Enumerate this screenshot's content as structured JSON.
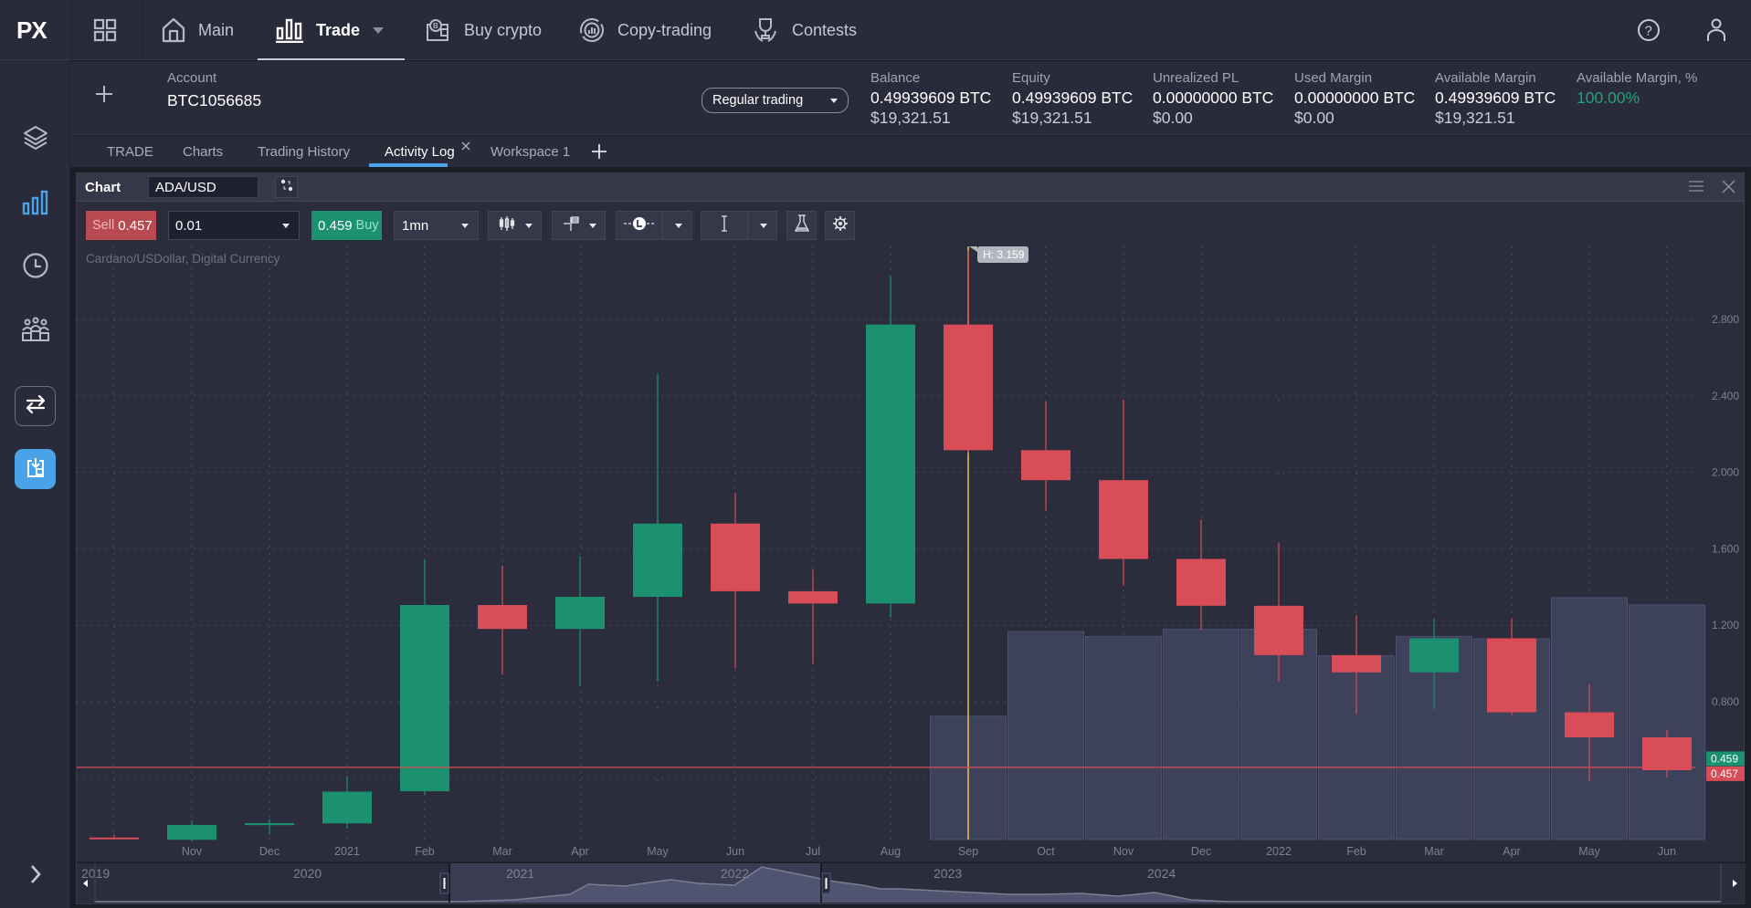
{
  "app": {
    "logo": "PX"
  },
  "topnav": {
    "items": [
      {
        "label": "Main",
        "icon": "home-icon"
      },
      {
        "label": "Trade",
        "icon": "bar-chart-icon",
        "active": true,
        "has_dropdown": true
      },
      {
        "label": "Buy crypto",
        "icon": "wallet-bitcoin-icon"
      },
      {
        "label": "Copy-trading",
        "icon": "copy-trading-icon"
      },
      {
        "label": "Contests",
        "icon": "trophy-icon"
      }
    ],
    "right_icons": [
      "help-icon",
      "user-icon"
    ]
  },
  "sidebar": {
    "items": [
      {
        "name": "layers",
        "icon": "layers-icon"
      },
      {
        "name": "charts",
        "icon": "bar-chart-icon",
        "active": true
      },
      {
        "name": "history",
        "icon": "clock-icon"
      },
      {
        "name": "community",
        "icon": "people-icon"
      },
      {
        "name": "transfer",
        "icon": "swap-arrows-icon"
      },
      {
        "name": "deposit",
        "icon": "deposit-icon",
        "highlight": true
      }
    ],
    "expand_icon": "chevron-right-icon"
  },
  "account": {
    "label": "Account",
    "id": "BTC1056685",
    "mode_select": "Regular trading",
    "stats": [
      {
        "label": "Balance",
        "btc": "0.49939609 BTC",
        "usd": "$19,321.51"
      },
      {
        "label": "Equity",
        "btc": "0.49939609 BTC",
        "usd": "$19,321.51"
      },
      {
        "label": "Unrealized PL",
        "btc": "0.00000000 BTC",
        "usd": "$0.00"
      },
      {
        "label": "Used Margin",
        "btc": "0.00000000 BTC",
        "usd": "$0.00"
      },
      {
        "label": "Available Margin",
        "btc": "0.49939609 BTC",
        "usd": "$19,321.51"
      },
      {
        "label": "Available Margin, %",
        "value": "100.00%"
      }
    ]
  },
  "tabs": [
    {
      "label": "TRADE"
    },
    {
      "label": "Charts"
    },
    {
      "label": "Trading History"
    },
    {
      "label": "Activity Log",
      "active": true,
      "closable": true
    },
    {
      "label": "Workspace 1"
    }
  ],
  "chart_panel": {
    "title": "Chart",
    "symbol": "ADA/USD",
    "subtitle": "Cardano/USDollar, Digital Currency",
    "sell": {
      "label": "Sell",
      "price": "0.457"
    },
    "buy": {
      "label": "Buy",
      "price": "0.459"
    },
    "quantity": "0.01",
    "timeframe": "1mn",
    "crosshair_label": "H: 3.159"
  },
  "colors": {
    "up": "#1b9170",
    "down": "#d84d57",
    "accent": "#4aa3e8",
    "positive_text": "#1fa27b",
    "crosshair": "#e5c54a"
  },
  "chart_data": {
    "type": "candlestick",
    "title": "Cardano/USDollar, Digital Currency",
    "ylim": [
      0.1,
      3.2
    ],
    "y_ticks": [
      "2.800",
      "2.400",
      "2.000",
      "1.600",
      "1.200",
      "0.800"
    ],
    "y_tick_values": [
      2.8,
      2.4,
      2.0,
      1.6,
      1.2,
      0.8
    ],
    "x_labels": [
      "",
      "Nov",
      "Dec",
      "2021",
      "Feb",
      "Mar",
      "Apr",
      "May",
      "Jun",
      "Jul",
      "Aug",
      "Sep",
      "Oct",
      "Nov",
      "Dec",
      "2022",
      "Feb",
      "Mar",
      "Apr",
      "May",
      "Jun"
    ],
    "candles": [
      {
        "o": 0.09,
        "h": 0.105,
        "l": 0.08,
        "c": 0.086
      },
      {
        "o": 0.078,
        "h": 0.18,
        "l": 0.07,
        "c": 0.156
      },
      {
        "o": 0.155,
        "h": 0.186,
        "l": 0.105,
        "c": 0.165
      },
      {
        "o": 0.164,
        "h": 0.41,
        "l": 0.137,
        "c": 0.33
      },
      {
        "o": 0.332,
        "h": 1.545,
        "l": 0.313,
        "c": 1.306
      },
      {
        "o": 1.306,
        "h": 1.513,
        "l": 0.942,
        "c": 1.181
      },
      {
        "o": 1.181,
        "h": 1.564,
        "l": 0.884,
        "c": 1.349
      },
      {
        "o": 1.349,
        "h": 2.516,
        "l": 0.907,
        "c": 1.732
      },
      {
        "o": 1.732,
        "h": 1.893,
        "l": 0.972,
        "c": 1.378
      },
      {
        "o": 1.378,
        "h": 1.49,
        "l": 0.997,
        "c": 1.314
      },
      {
        "o": 1.314,
        "h": 3.03,
        "l": 1.24,
        "c": 2.773
      },
      {
        "o": 2.773,
        "h": 3.159,
        "l": 2.1,
        "c": 2.116
      },
      {
        "o": 2.116,
        "h": 2.37,
        "l": 1.8,
        "c": 1.959
      },
      {
        "o": 1.959,
        "h": 2.38,
        "l": 1.408,
        "c": 1.547
      },
      {
        "o": 1.547,
        "h": 1.754,
        "l": 1.175,
        "c": 1.302
      },
      {
        "o": 1.302,
        "h": 1.633,
        "l": 0.907,
        "c": 1.044
      },
      {
        "o": 1.044,
        "h": 1.253,
        "l": 0.735,
        "c": 0.954
      },
      {
        "o": 0.954,
        "h": 1.236,
        "l": 0.762,
        "c": 1.132
      },
      {
        "o": 1.132,
        "h": 1.236,
        "l": 0.727,
        "c": 0.745
      },
      {
        "o": 0.745,
        "h": 0.892,
        "l": 0.385,
        "c": 0.614
      },
      {
        "o": 0.614,
        "h": 0.653,
        "l": 0.405,
        "c": 0.442
      }
    ],
    "volume_relative": [
      null,
      null,
      null,
      null,
      null,
      null,
      null,
      null,
      null,
      null,
      null,
      0.51,
      0.86,
      0.84,
      0.87,
      0.87,
      0.76,
      0.84,
      0.83,
      1.0,
      0.97
    ],
    "price_lines": [
      {
        "label": "0.459",
        "value": 0.459,
        "kind": "buy"
      },
      {
        "label": "0.457",
        "value": 0.457,
        "kind": "sell"
      }
    ],
    "crosshair_index": 11,
    "navigator": {
      "year_labels": [
        "2019",
        "2020",
        "2021",
        "2022",
        "2023",
        "2024"
      ],
      "selection_range": [
        "2021",
        "2022"
      ]
    }
  }
}
